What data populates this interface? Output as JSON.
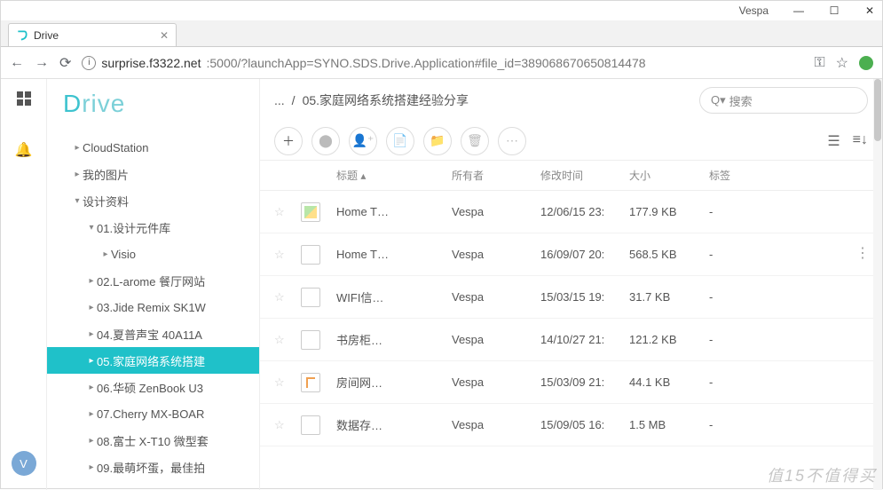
{
  "window": {
    "user": "Vespa"
  },
  "browser": {
    "tab_title": "Drive",
    "url_host": "surprise.f3322.net",
    "url_path": ":5000/?launchApp=SYNO.SDS.Drive.Application#file_id=389068670650814478"
  },
  "app": {
    "logo": "Drive",
    "avatar_initial": "V",
    "tree": [
      {
        "label": "CloudStation",
        "level": 1,
        "expanded": false
      },
      {
        "label": "我的图片",
        "level": 1,
        "expanded": false
      },
      {
        "label": "设计资料",
        "level": 1,
        "expanded": true
      },
      {
        "label": "01.设计元件库",
        "level": 2,
        "expanded": true
      },
      {
        "label": "Visio",
        "level": 3,
        "expanded": false
      },
      {
        "label": "02.L-arome 餐厅网站",
        "level": 2,
        "expanded": false
      },
      {
        "label": "03.Jide Remix SK1W",
        "level": 2,
        "expanded": false
      },
      {
        "label": "04.夏普声宝 40A11A",
        "level": 2,
        "expanded": false
      },
      {
        "label": "05.家庭网络系统搭建",
        "level": 2,
        "expanded": false,
        "selected": true
      },
      {
        "label": "06.华硕 ZenBook U3",
        "level": 2,
        "expanded": false
      },
      {
        "label": "07.Cherry MX-BOAR",
        "level": 2,
        "expanded": false
      },
      {
        "label": "08.富士 X-T10 微型套",
        "level": 2,
        "expanded": false
      },
      {
        "label": "09.最萌坏蛋，最佳拍",
        "level": 2,
        "expanded": false
      }
    ],
    "breadcrumb": {
      "prefix": "...",
      "sep": "/",
      "current": "05.家庭网络系统搭建经验分享"
    },
    "search_placeholder": "搜索",
    "columns": {
      "title": "标题",
      "owner": "所有者",
      "time": "修改时间",
      "size": "大小",
      "tag": "标签"
    },
    "files": [
      {
        "icon": "img",
        "title": "Home T…",
        "owner": "Vespa",
        "time": "12/06/15 23:",
        "size": "177.9 KB",
        "tag": "-"
      },
      {
        "icon": "file",
        "title": "Home T…",
        "owner": "Vespa",
        "time": "16/09/07 20:",
        "size": "568.5 KB",
        "tag": "-"
      },
      {
        "icon": "file",
        "title": "WIFI信…",
        "owner": "Vespa",
        "time": "15/03/15 19:",
        "size": "31.7 KB",
        "tag": "-"
      },
      {
        "icon": "file",
        "title": "书房柜…",
        "owner": "Vespa",
        "time": "14/10/27 21:",
        "size": "121.2 KB",
        "tag": "-"
      },
      {
        "icon": "doc",
        "title": "房间网…",
        "owner": "Vespa",
        "time": "15/03/09 21:",
        "size": "44.1 KB",
        "tag": "-"
      },
      {
        "icon": "file",
        "title": "数据存…",
        "owner": "Vespa",
        "time": "15/09/05 16:",
        "size": "1.5 MB",
        "tag": "-"
      }
    ],
    "watermark": "值15不值得买"
  }
}
